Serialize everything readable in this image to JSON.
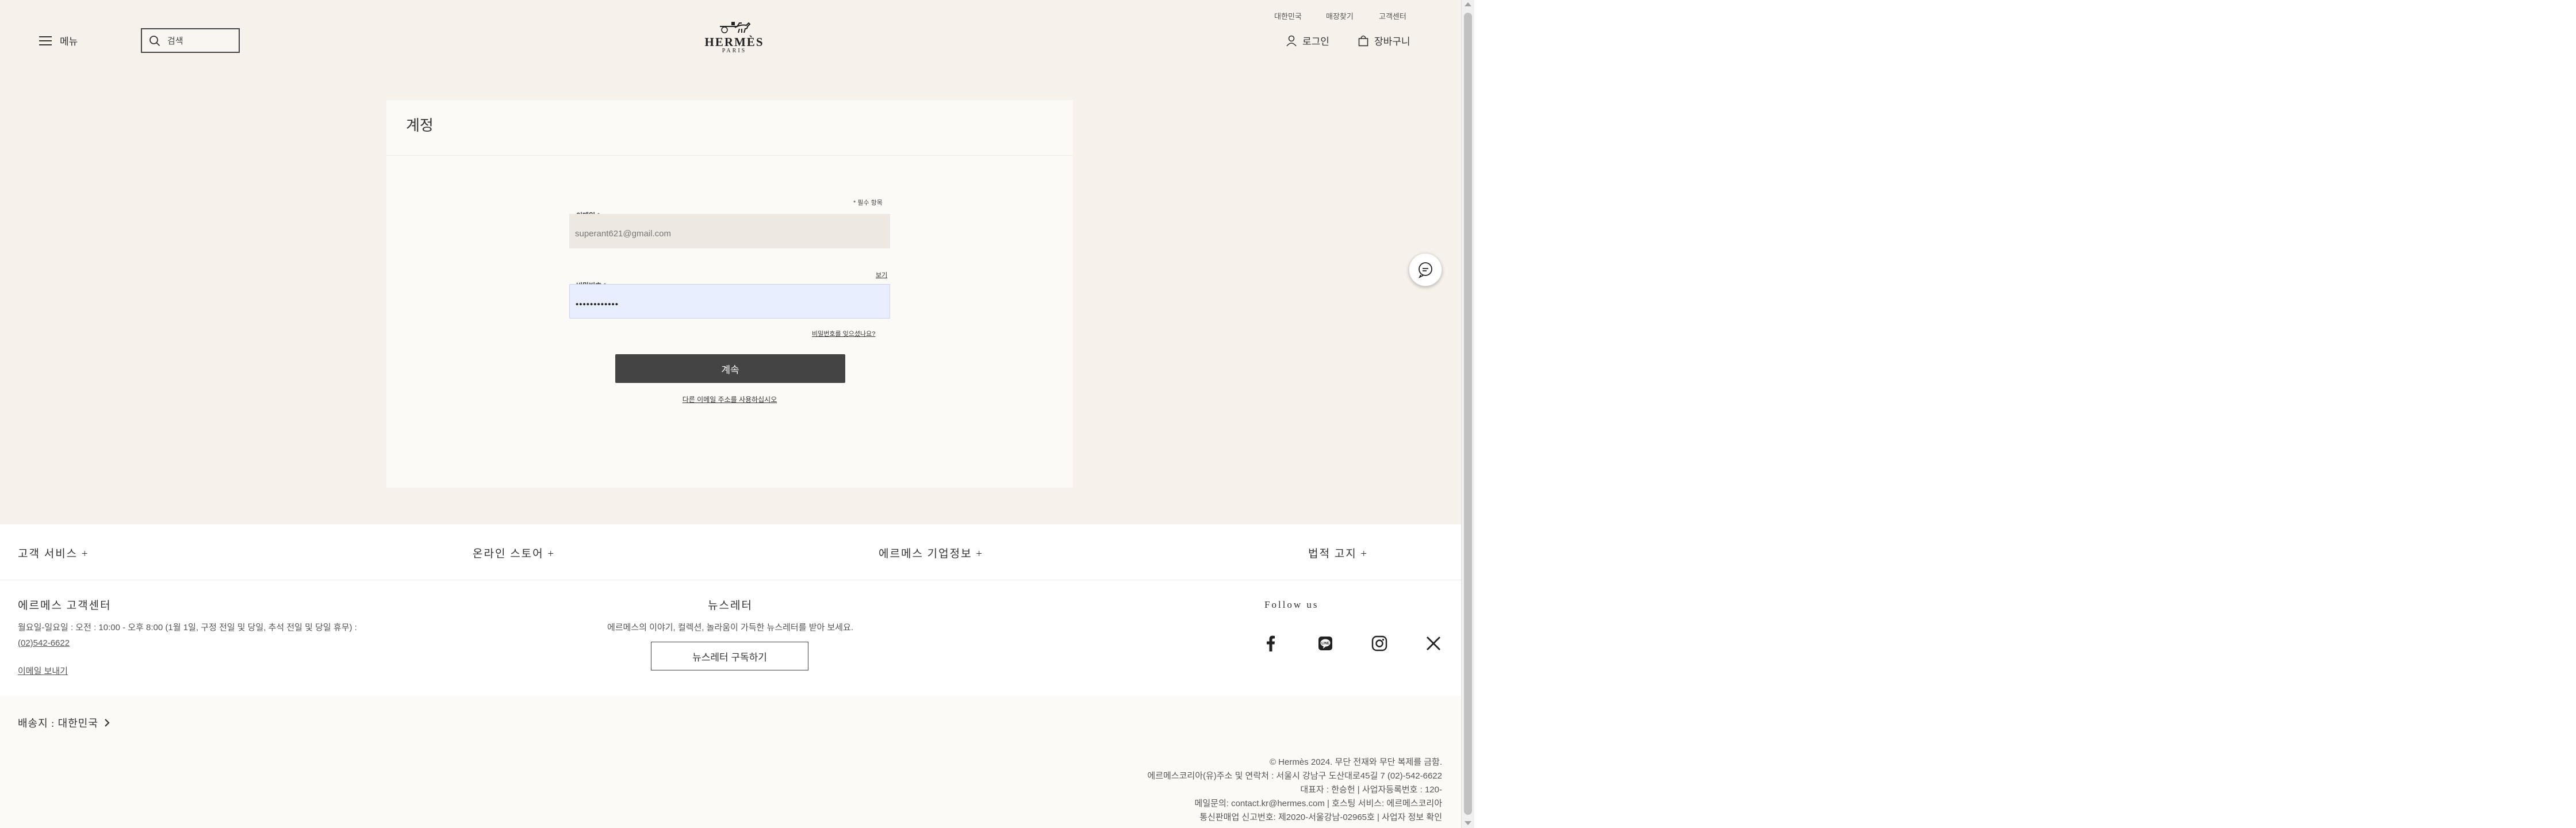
{
  "header": {
    "top_links": [
      "대한민국",
      "매장찾기",
      "고객센터"
    ],
    "menu_label": "메뉴",
    "search_placeholder": "검색",
    "logo_text": "HERMÈS",
    "logo_sub": "PARIS",
    "login_label": "로그인",
    "cart_label": "장바구니"
  },
  "account": {
    "title": "계정",
    "required_note": "* 필수 항목",
    "email_label": "이메일 *",
    "email_value": "superant621@gmail.com",
    "show_label": "보기",
    "password_label": "비밀번호 *",
    "password_value": "••••••••••••",
    "forgot_label": "비밀번호를 잊으셨나요?",
    "continue_label": "계속",
    "other_email_label": "다른 이메일 주소를 사용하십시오"
  },
  "footer": {
    "accordions": [
      "고객 서비스 +",
      "온라인 스토어 +",
      "에르메스 기업정보 +",
      "법적 고지 +"
    ],
    "customer_center": {
      "title": "에르메스 고객센터",
      "hours": "월요일-일요일 : 오전 : 10:00 - 오후 8:00 (1월 1일, 구정 전일 및 당일, 추석 전일 및 당일 휴무) :",
      "phone": "(02)542-6622",
      "email_link": "이메일 보내기"
    },
    "newsletter": {
      "title": "뉴스레터",
      "desc": "에르메스의 이야기, 컬렉션, 놀라움이 가득한 뉴스레터를 받아 보세요.",
      "button": "뉴스레터 구독하기"
    },
    "follow": {
      "title": "Follow us",
      "icons": [
        "facebook-icon",
        "line-icon",
        "instagram-icon",
        "x-icon"
      ]
    },
    "ship_to": "배송지 : 대한민국",
    "legal_lines": [
      "© Hermès 2024. 무단 전재와 무단 복제를 금함.",
      "에르메스코리아(유)주소 및 연락처 : 서울시 강남구 도산대로45길 7 (02)-542-6622",
      "대표자 : 한승헌 | 사업자등록번호 : 120-",
      "메일문의: contact.kr@hermes.com | 호스팅 서비스: 에르메스코리아",
      "통신판매업 신고번호: 제2020-서울강남-02965호 | 사업자 정보 확인"
    ]
  },
  "colors": {
    "page_bg": "#f6f1eb",
    "card_bg": "#fcfaf6",
    "button_dark": "#444444",
    "autofill_bg": "#e8eefd"
  }
}
